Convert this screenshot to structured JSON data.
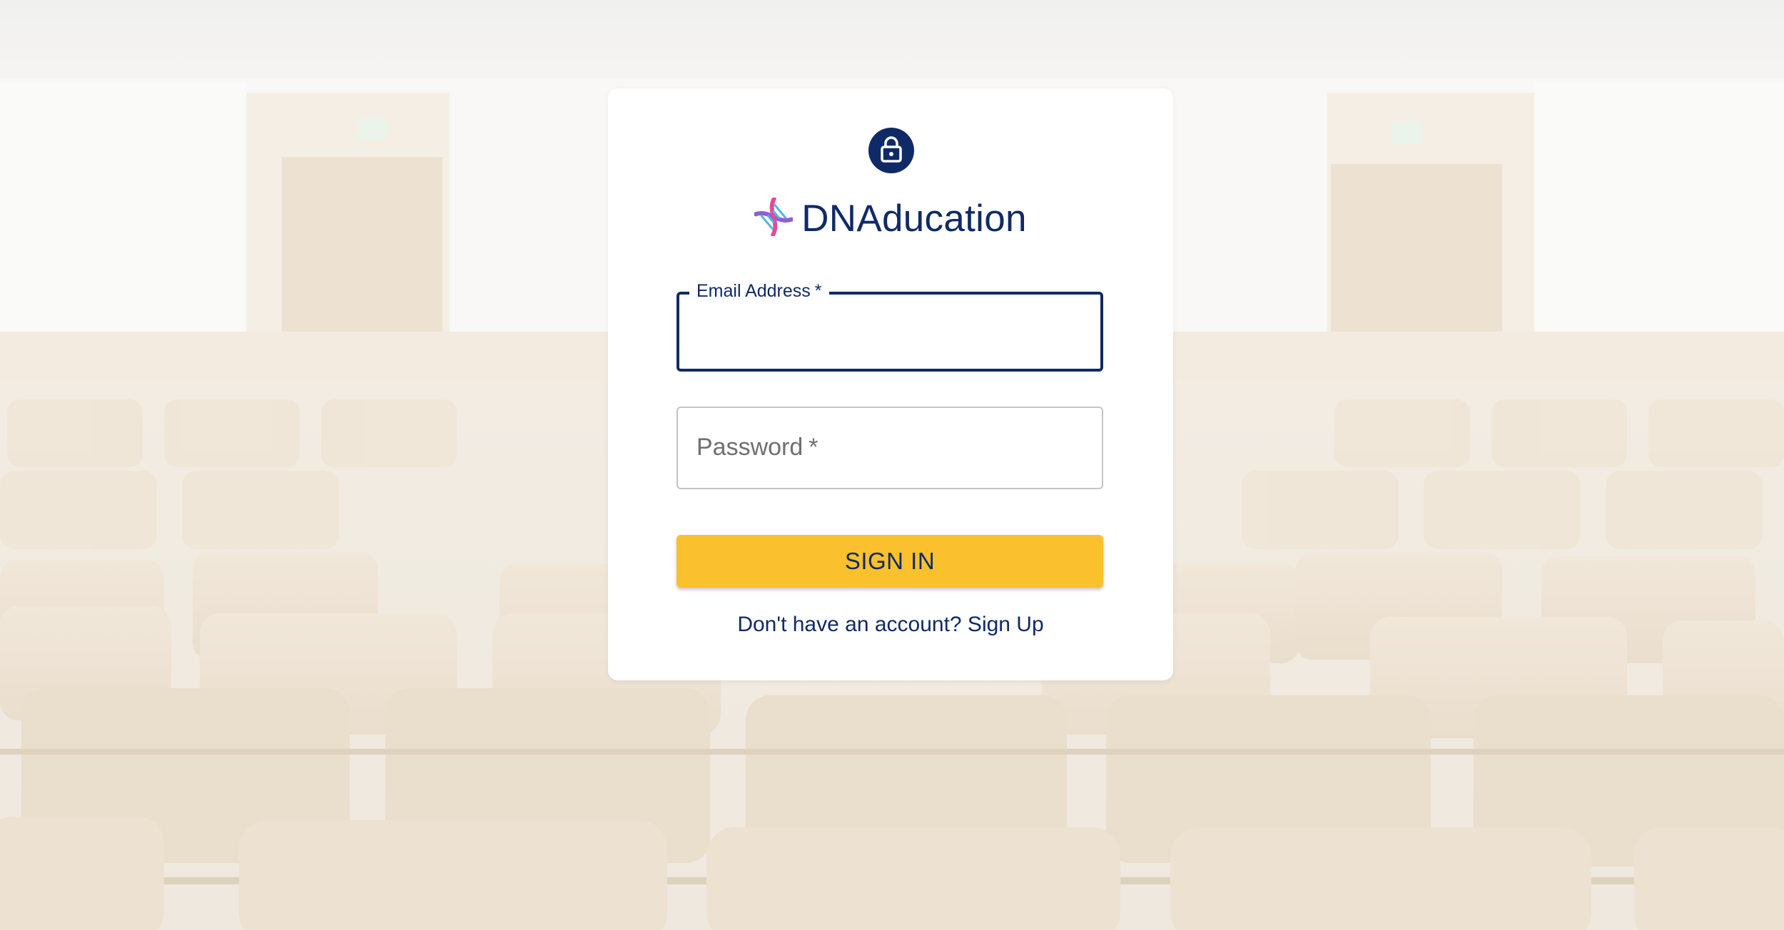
{
  "brand": {
    "name": "DNAducation",
    "logo_icon": "dna-icon",
    "lock_icon": "lock-icon"
  },
  "form": {
    "email_label": "Email Address",
    "email_required_mark": "*",
    "email_value": "",
    "password_label": "Password",
    "password_required_mark": "*",
    "password_value": ""
  },
  "actions": {
    "signin_label": "SIGN IN",
    "signup_text": "Don't have an account? Sign Up"
  },
  "colors": {
    "primary": "#0f2a66",
    "accent": "#fbc02d",
    "background_tint": "#efe7dc"
  }
}
